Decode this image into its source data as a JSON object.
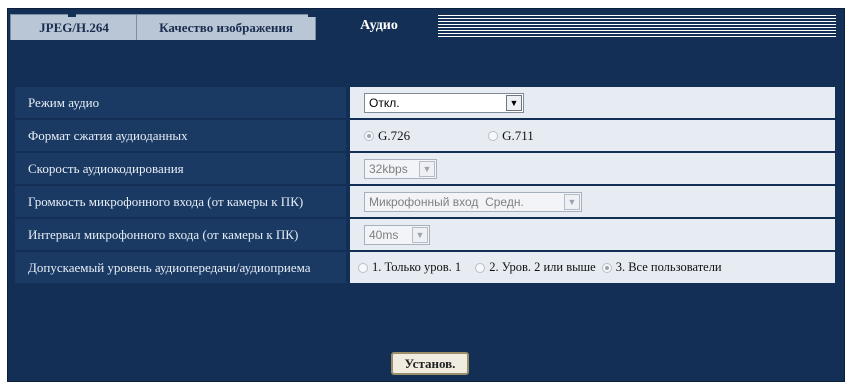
{
  "tabs": [
    {
      "label": "JPEG/H.264",
      "active": false
    },
    {
      "label": "Качество изображения",
      "active": false
    },
    {
      "label": "Аудио",
      "active": true
    }
  ],
  "rows": [
    {
      "label": "Режим аудио",
      "select": {
        "value": "Откл.",
        "disabled": false
      }
    },
    {
      "label": "Формат сжатия аудиоданных",
      "radios": [
        {
          "label": "G.726",
          "selected": true
        },
        {
          "label": "G.711",
          "selected": false
        }
      ]
    },
    {
      "label": "Скорость аудиокодирования",
      "select": {
        "value": "32kbps",
        "disabled": true
      }
    },
    {
      "label": "Громкость микрофонного входа (от камеры к ПК)",
      "select": {
        "value": "Микрофонный вход  Средн.",
        "disabled": true
      }
    },
    {
      "label": "Интервал микрофонного входа (от камеры к ПК)",
      "select": {
        "value": "40ms",
        "disabled": true
      }
    },
    {
      "label": "Допускаемый уровень аудиопередачи/аудиоприема",
      "radios": [
        {
          "label": "1. Только уров. 1",
          "selected": false
        },
        {
          "label": "2. Уров. 2 или выше",
          "selected": false
        },
        {
          "label": "3. Все пользователи",
          "selected": true
        }
      ]
    }
  ],
  "set_button": "Установ.",
  "colors": {
    "background": "#142f55",
    "label_cell": "#1a3a64",
    "value_cell": "#e7ecf2",
    "tab_inactive": "#b9c6d6"
  }
}
